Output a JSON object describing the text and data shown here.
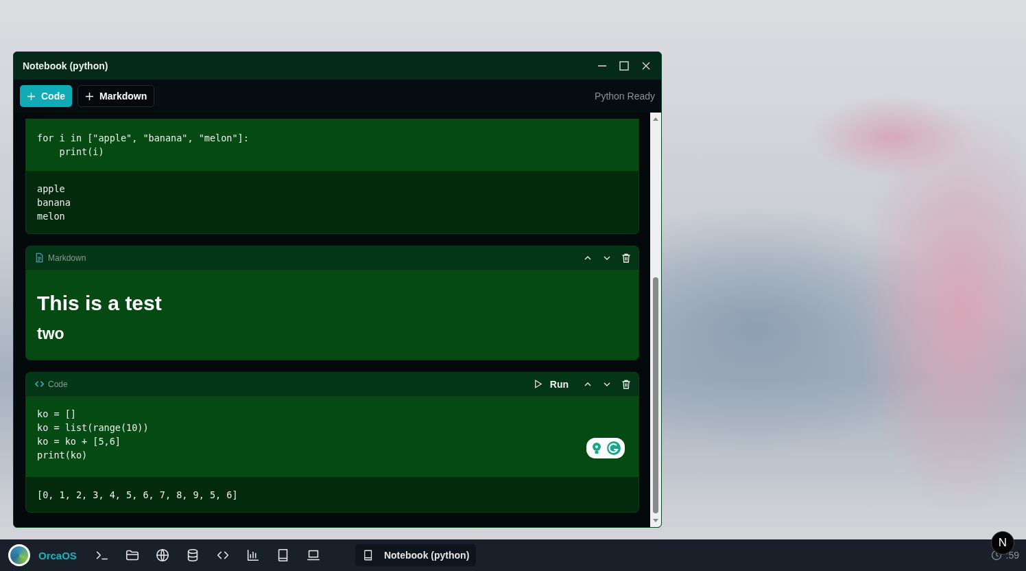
{
  "window": {
    "title": "Notebook (python)"
  },
  "toolbar": {
    "buttons": [
      {
        "label": "Code",
        "kind": "primary"
      },
      {
        "label": "Markdown",
        "kind": "secondary"
      }
    ],
    "status": "Python Ready"
  },
  "cells": [
    {
      "kind": "code",
      "code": [
        "for i in [\"apple\", \"banana\", \"melon\"]:",
        "    print(i)"
      ],
      "output": [
        "apple",
        "banana",
        "melon"
      ]
    },
    {
      "kind": "markdown",
      "label": "Markdown",
      "blocks": [
        {
          "kind": "h1",
          "text": "This is a test"
        },
        {
          "kind": "h2",
          "text": "two"
        }
      ]
    },
    {
      "kind": "code",
      "label": "Code",
      "run_label": "Run",
      "code": [
        "ko = []",
        "ko = list(range(10))",
        "ko = ko + [5,6]",
        "print(ko)"
      ],
      "output": [
        "[0, 1, 2, 3, 4, 5, 6, 7, 8, 9, 5, 6]"
      ]
    }
  ],
  "taskbar": {
    "brand": "OrcaOS",
    "windows": [
      {
        "title": "Notebook (python)",
        "selected": true
      }
    ],
    "time": ":59",
    "badge": "N"
  }
}
